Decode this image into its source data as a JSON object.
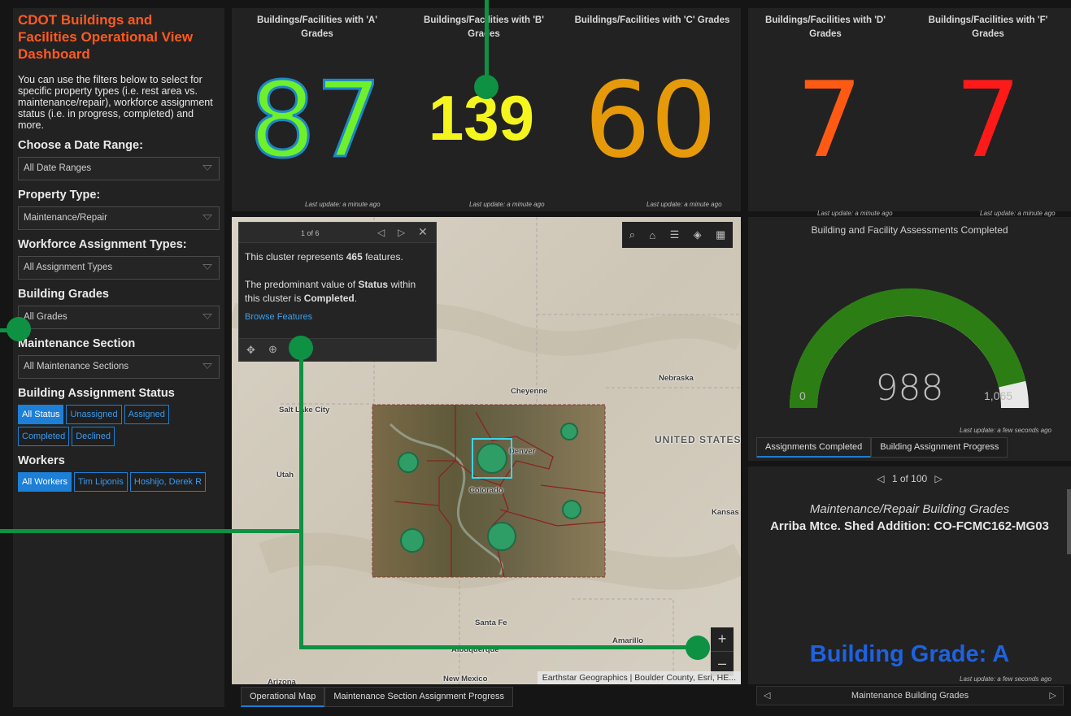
{
  "sidebar": {
    "title": "CDOT Buildings and\nFacilities Operational View\nDashboard",
    "description": "You can use the filters below to select for specific property types (i.e. rest area vs. maintenance/repair), workforce assignment status (i.e. in progress, completed) and more.",
    "filters": [
      {
        "label": "Choose a Date Range:",
        "value": "All Date Ranges"
      },
      {
        "label": "Property Type:",
        "value": "Maintenance/Repair"
      },
      {
        "label": "Workforce Assignment Types:",
        "value": "All Assignment Types"
      },
      {
        "label": "Building Grades",
        "value": "All Grades"
      },
      {
        "label": "Maintenance Section",
        "value": "All Maintenance Sections"
      }
    ],
    "status_label": "Building Assignment Status",
    "status_chips": [
      "All Status",
      "Unassigned",
      "Assigned",
      "Completed",
      "Declined"
    ],
    "workers_label": "Workers",
    "worker_chips": [
      "All Workers",
      "Tim Liponis",
      "Hoshijo, Derek R"
    ]
  },
  "kpis": [
    {
      "title": "Buildings/Facilities with 'A' Grades",
      "value": "87",
      "color": "#6ef02b"
    },
    {
      "title": "Buildings/Facilities with 'B' Grades",
      "value": "139",
      "color": "#f5f51e"
    },
    {
      "title": "Buildings/Facilities with 'C' Grades",
      "value": "60",
      "color": "#e69a0a"
    },
    {
      "title": "Buildings/Facilities with 'D' Grades",
      "value": "7",
      "color": "#ff5a14"
    },
    {
      "title": "Buildings/Facilities with 'F' Grades",
      "value": "7",
      "color": "#ff1a1a"
    }
  ],
  "last_update": "Last update: a minute ago",
  "last_update_seconds": "Last update: a few seconds ago",
  "gauge": {
    "title": "Building and Facility Assessments Completed",
    "value": "988",
    "min": "0",
    "max": "1,065",
    "value_num": 988,
    "max_num": 1065,
    "color": "#2b7d14"
  },
  "gauge_tabs": [
    "Assignments Completed",
    "Building Assignment Progress"
  ],
  "map": {
    "popup": {
      "pager": "1 of 6",
      "line1_pre": "This cluster represents ",
      "line1_bold": "465",
      "line1_post": " features.",
      "line2_pre": "The predominant value of ",
      "line2_bold": "Status",
      "line2_mid": " within this cluster is ",
      "line2_bold2": "Completed",
      "line2_post": ".",
      "browse": "Browse Features"
    },
    "places": {
      "cheyenne": "Cheyenne",
      "salt_lake": "Salt Lake City",
      "nebraska": "Nebraska",
      "united_states": "UNITED STATES",
      "denver": "Denver",
      "colorado": "Colorado",
      "utah": "Utah",
      "kansas": "Kansas",
      "santa_fe": "Santa Fe",
      "albuquerque": "Albuquerque",
      "amarillo": "Amarillo",
      "new_mexico": "New Mexico",
      "arizona": "Arizona"
    },
    "attribution": "Earthstar Geographics | Boulder County, Esri, HE...",
    "zoom_in": "+",
    "zoom_out": "–"
  },
  "map_tabs": [
    "Operational Map",
    "Maintenance Section Assignment Progress"
  ],
  "list": {
    "pager": "1 of 100",
    "heading": "Maintenance/Repair Building Grades",
    "item": "Arriba Mtce. Shed Addition: CO-FCMC162-MG03",
    "grade": "Building Grade: A",
    "footer": "Maintenance Building Grades"
  }
}
